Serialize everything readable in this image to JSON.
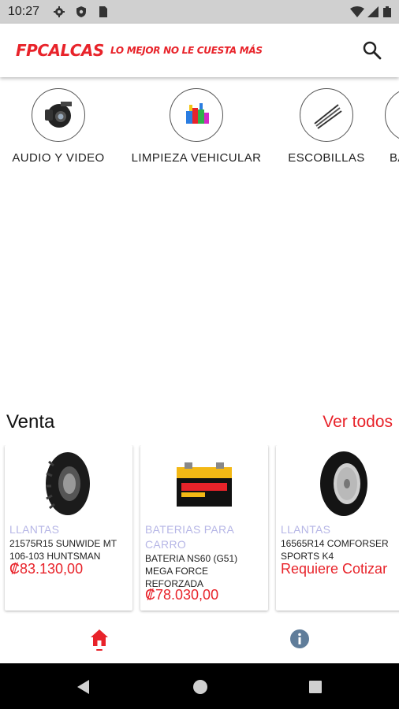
{
  "status": {
    "time": "10:27",
    "icons": [
      "gear-icon",
      "shield-icon",
      "sim-card-icon",
      "wifi-icon",
      "signal-icon",
      "battery-icon"
    ]
  },
  "header": {
    "logo": "FPCALCAS",
    "slogan": "LO MEJOR NO LE CUESTA MÁS",
    "search_icon": "search-icon",
    "brand_color": "#e8232a"
  },
  "categories": [
    {
      "label": "AUDIO Y VIDEO",
      "icon": "camera-icon"
    },
    {
      "label": "LIMPIEZA VEHICULAR",
      "icon": "cleaning-products-icon"
    },
    {
      "label": "ESCOBILLAS",
      "icon": "wiper-blades-icon"
    },
    {
      "label": "BA",
      "icon": "battery-icon"
    }
  ],
  "section": {
    "title": "Venta",
    "link": "Ver todos"
  },
  "products": [
    {
      "category": "LLANTAS",
      "name": "21575R15 SUNWIDE MT 106-103 HUNTSMAN",
      "price": "₡83.130,00",
      "image": "tire-icon"
    },
    {
      "category": "BATERIAS PARA CARRO",
      "name": "BATERIA NS60 (G51) MEGA FORCE REFORZADA",
      "price": "₡78.030,00",
      "image": "car-battery-icon"
    },
    {
      "category": "LLANTAS",
      "name": "16565R14 COMFORSER SPORTS K4",
      "price": "Requiere Cotizar",
      "image": "tire-icon"
    }
  ],
  "bottom_nav": [
    {
      "icon": "home-icon",
      "active": true
    },
    {
      "icon": "info-icon",
      "active": false
    }
  ],
  "system_nav": [
    "back-icon",
    "home-circle-icon",
    "recents-icon"
  ]
}
